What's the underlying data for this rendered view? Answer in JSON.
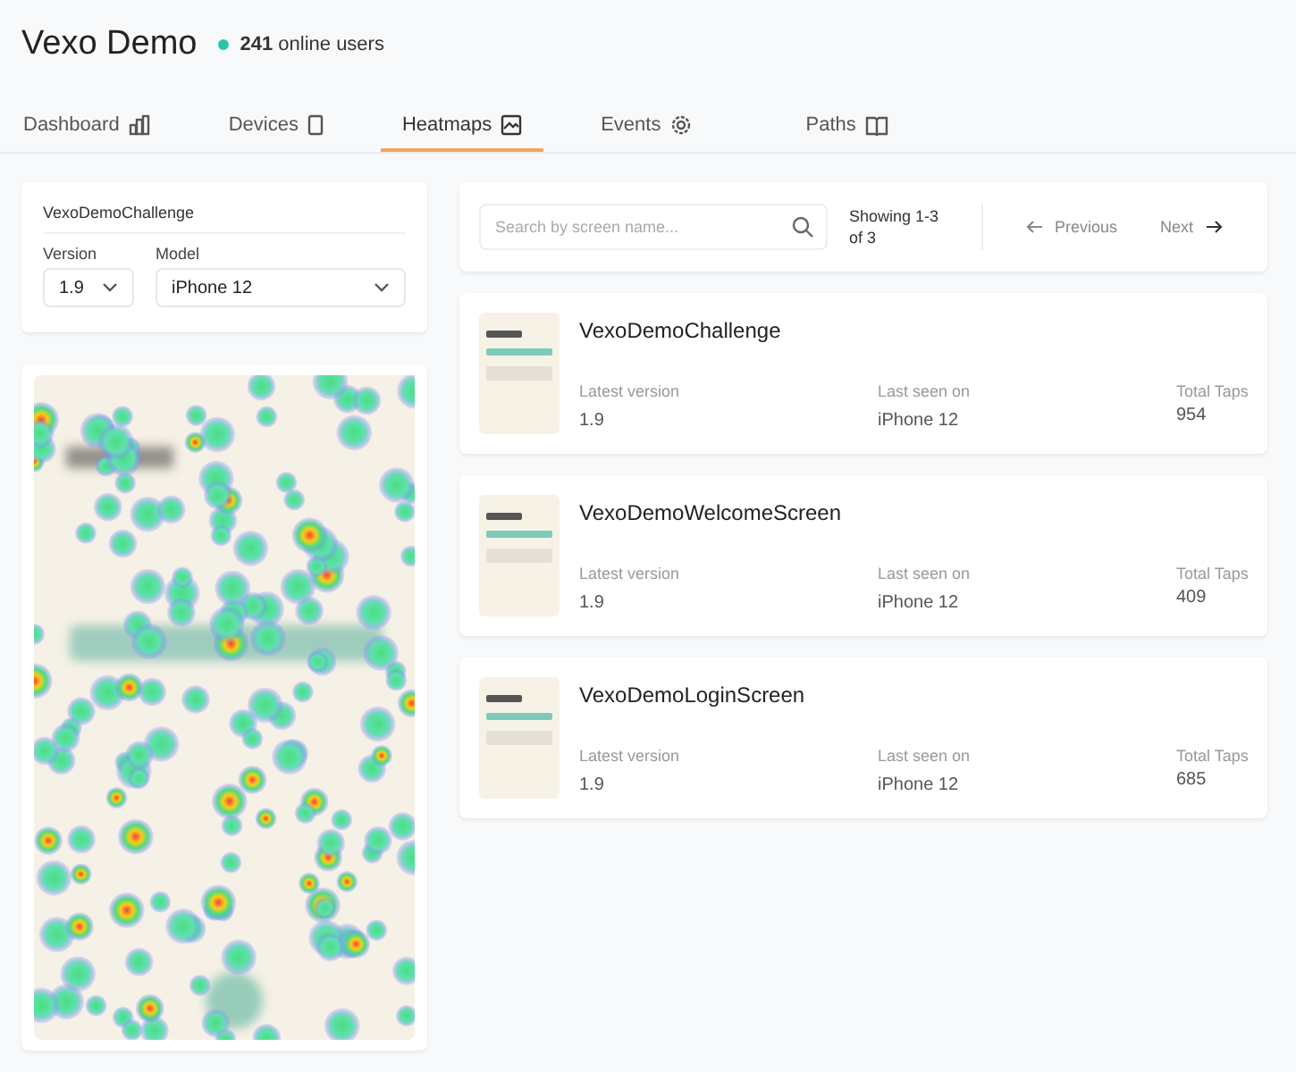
{
  "app": {
    "title": "Vexo Demo",
    "online_count": "241",
    "online_label": "online users"
  },
  "tabs": [
    {
      "label": "Dashboard",
      "kind": "chart",
      "selected": false
    },
    {
      "label": "Devices",
      "kind": "phone",
      "selected": false
    },
    {
      "label": "Heatmaps",
      "kind": "image",
      "selected": true
    },
    {
      "label": "Events",
      "kind": "gear",
      "selected": false
    },
    {
      "label": "Paths",
      "kind": "book",
      "selected": false
    }
  ],
  "filter": {
    "screen": "VexoDemoChallenge",
    "version_label": "Version",
    "version": "1.9",
    "model_label": "Model",
    "model": "iPhone 12"
  },
  "search": {
    "placeholder": "Search by screen name...",
    "showing": "Showing 1-3 of 3",
    "previous": "Previous",
    "next": "Next"
  },
  "screens": [
    {
      "name": "VexoDemoChallenge",
      "version_label": "Latest version",
      "version": "1.9",
      "seen_label": "Last seen on",
      "seen": "iPhone 12",
      "taps_label": "Total Taps",
      "taps": "954"
    },
    {
      "name": "VexoDemoWelcomeScreen",
      "version_label": "Latest version",
      "version": "1.9",
      "seen_label": "Last seen on",
      "seen": "iPhone 12",
      "taps_label": "Total Taps",
      "taps": "409"
    },
    {
      "name": "VexoDemoLoginScreen",
      "version_label": "Latest version",
      "version": "1.9",
      "seen_label": "Last seen on",
      "seen": "iPhone 12",
      "taps_label": "Total Taps",
      "taps": "685"
    }
  ]
}
